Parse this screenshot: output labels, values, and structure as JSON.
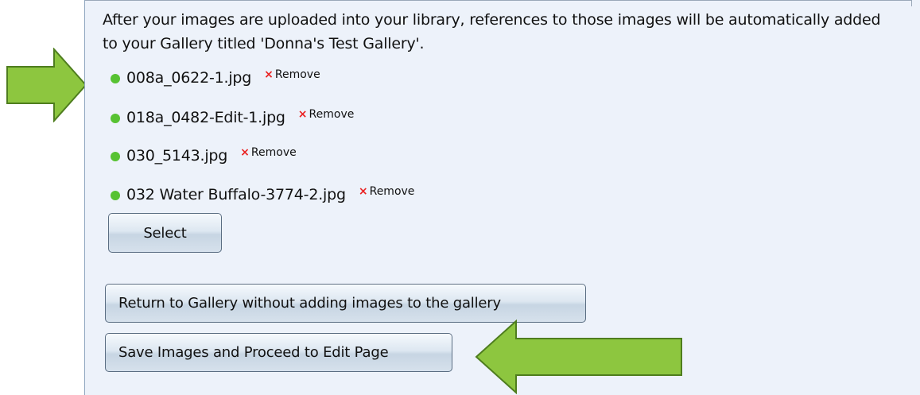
{
  "intro_text": "After your images are uploaded into your library, references to those images will be automatically added to your Gallery titled 'Donna's Test Gallery'.",
  "files": [
    {
      "name": "008a_0622-1.jpg",
      "remove_label": "Remove"
    },
    {
      "name": "018a_0482-Edit-1.jpg",
      "remove_label": "Remove"
    },
    {
      "name": "030_5143.jpg",
      "remove_label": "Remove"
    },
    {
      "name": "032 Water Buffalo-3774-2.jpg",
      "remove_label": "Remove"
    }
  ],
  "remove_icon_glyph": "×",
  "buttons": {
    "select": "Select",
    "return": "Return to Gallery without adding images to the gallery",
    "save": "Save Images and Proceed to Edit Page"
  },
  "colors": {
    "panel_background": "#edf2fa",
    "status_dot": "#57c232",
    "remove_icon": "#ea2121",
    "annotation_arrow_fill": "#8dc63f",
    "annotation_arrow_stroke": "#4e7d1e"
  },
  "icons": {
    "status": "green-status-dot-icon",
    "remove": "red-x-icon",
    "annotation": "green-arrow-icon"
  }
}
